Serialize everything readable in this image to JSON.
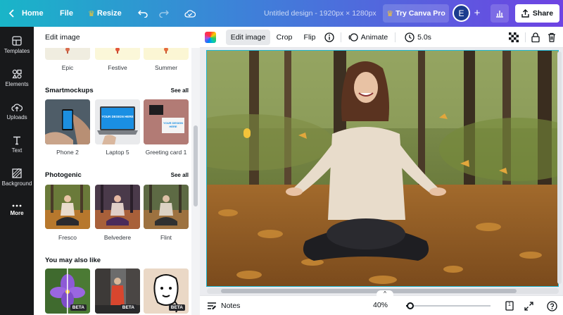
{
  "topbar": {
    "home_label": "Home",
    "file_label": "File",
    "resize_label": "Resize",
    "title": "Untitled design - 1920px × 1280px",
    "try_pro_label": "Try Canva Pro",
    "avatar_initial": "E",
    "share_label": "Share"
  },
  "rail": {
    "items": [
      {
        "label": "Templates",
        "icon": "templates-icon"
      },
      {
        "label": "Elements",
        "icon": "elements-icon"
      },
      {
        "label": "Uploads",
        "icon": "uploads-icon"
      },
      {
        "label": "Text",
        "icon": "text-icon"
      },
      {
        "label": "Background",
        "icon": "background-icon"
      },
      {
        "label": "More",
        "icon": "more-icon"
      }
    ]
  },
  "panel": {
    "title": "Edit image",
    "filters": [
      {
        "label": "Epic"
      },
      {
        "label": "Festive"
      },
      {
        "label": "Summer"
      }
    ],
    "smartmockups": {
      "title": "Smartmockups",
      "see_all": "See all",
      "items": [
        {
          "label": "Phone 2"
        },
        {
          "label": "Laptop 5",
          "screen_text": "YOUR DESIGN HERE"
        },
        {
          "label": "Greeting card 1",
          "card_text": "YOUR DESIGN HERE"
        }
      ]
    },
    "photogenic": {
      "title": "Photogenic",
      "see_all": "See all",
      "items": [
        {
          "label": "Fresco"
        },
        {
          "label": "Belvedere"
        },
        {
          "label": "Flint"
        }
      ]
    },
    "also_like": {
      "title": "You may also like",
      "badge": "BETA",
      "items": [
        {
          "badge": "BETA"
        },
        {
          "badge": "BETA"
        },
        {
          "badge": "BETA"
        }
      ]
    }
  },
  "toolbar": {
    "edit_image": "Edit image",
    "crop": "Crop",
    "flip": "Flip",
    "animate": "Animate",
    "duration": "5.0s"
  },
  "bottombar": {
    "notes": "Notes",
    "zoom": "40%",
    "zoom_fraction": 0.05,
    "page_count": "1"
  },
  "colors": {
    "accent": "#1fb7d0",
    "rail_bg": "#18191b",
    "gradient_start": "#19b5c8",
    "gradient_end": "#6e43e3"
  }
}
